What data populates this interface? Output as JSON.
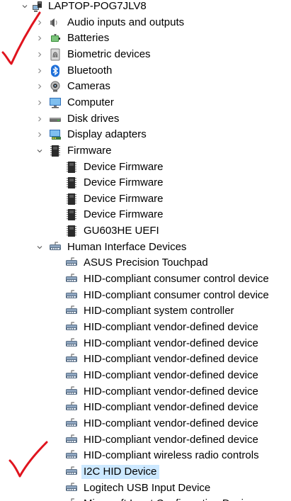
{
  "tree": {
    "root": {
      "label": "LAPTOP-POG7JLV8",
      "icon": "computer-root-icon",
      "expanded": true
    },
    "categories": [
      {
        "label": "Audio inputs and outputs",
        "icon": "speaker-icon",
        "expanded": false
      },
      {
        "label": "Batteries",
        "icon": "battery-icon",
        "expanded": false
      },
      {
        "label": "Biometric devices",
        "icon": "fingerprint-icon",
        "expanded": false
      },
      {
        "label": "Bluetooth",
        "icon": "bluetooth-icon",
        "expanded": false
      },
      {
        "label": "Cameras",
        "icon": "webcam-icon",
        "expanded": false
      },
      {
        "label": "Computer",
        "icon": "monitor-icon",
        "expanded": false
      },
      {
        "label": "Disk drives",
        "icon": "disk-drive-icon",
        "expanded": false
      },
      {
        "label": "Display adapters",
        "icon": "display-adapter-icon",
        "expanded": false
      },
      {
        "label": "Firmware",
        "icon": "firmware-chip-icon",
        "expanded": true,
        "children": [
          {
            "label": "Device Firmware",
            "icon": "firmware-chip-icon"
          },
          {
            "label": "Device Firmware",
            "icon": "firmware-chip-icon"
          },
          {
            "label": "Device Firmware",
            "icon": "firmware-chip-icon"
          },
          {
            "label": "Device Firmware",
            "icon": "firmware-chip-icon"
          },
          {
            "label": "GU603HE UEFI",
            "icon": "firmware-chip-icon"
          }
        ]
      },
      {
        "label": "Human Interface Devices",
        "icon": "hid-icon",
        "expanded": true,
        "children": [
          {
            "label": "ASUS Precision Touchpad",
            "icon": "hid-icon"
          },
          {
            "label": "HID-compliant consumer control device",
            "icon": "hid-icon"
          },
          {
            "label": "HID-compliant consumer control device",
            "icon": "hid-icon"
          },
          {
            "label": "HID-compliant system controller",
            "icon": "hid-icon"
          },
          {
            "label": "HID-compliant vendor-defined device",
            "icon": "hid-icon"
          },
          {
            "label": "HID-compliant vendor-defined device",
            "icon": "hid-icon"
          },
          {
            "label": "HID-compliant vendor-defined device",
            "icon": "hid-icon"
          },
          {
            "label": "HID-compliant vendor-defined device",
            "icon": "hid-icon"
          },
          {
            "label": "HID-compliant vendor-defined device",
            "icon": "hid-icon"
          },
          {
            "label": "HID-compliant vendor-defined device",
            "icon": "hid-icon"
          },
          {
            "label": "HID-compliant vendor-defined device",
            "icon": "hid-icon"
          },
          {
            "label": "HID-compliant vendor-defined device",
            "icon": "hid-icon"
          },
          {
            "label": "HID-compliant wireless radio controls",
            "icon": "hid-icon"
          },
          {
            "label": "I2C HID Device",
            "icon": "hid-icon",
            "selected": true
          },
          {
            "label": "Logitech USB Input Device",
            "icon": "hid-icon"
          },
          {
            "label": "Microsoft Input Configuration Device",
            "icon": "hid-icon"
          }
        ]
      }
    ]
  },
  "annotations": {
    "check_color": "#e0141e",
    "check_marks": [
      "red-check-mark-root",
      "red-check-mark-i2c"
    ]
  },
  "colors": {
    "selection": "#cce8ff",
    "chevron": "#7a7a7a"
  }
}
